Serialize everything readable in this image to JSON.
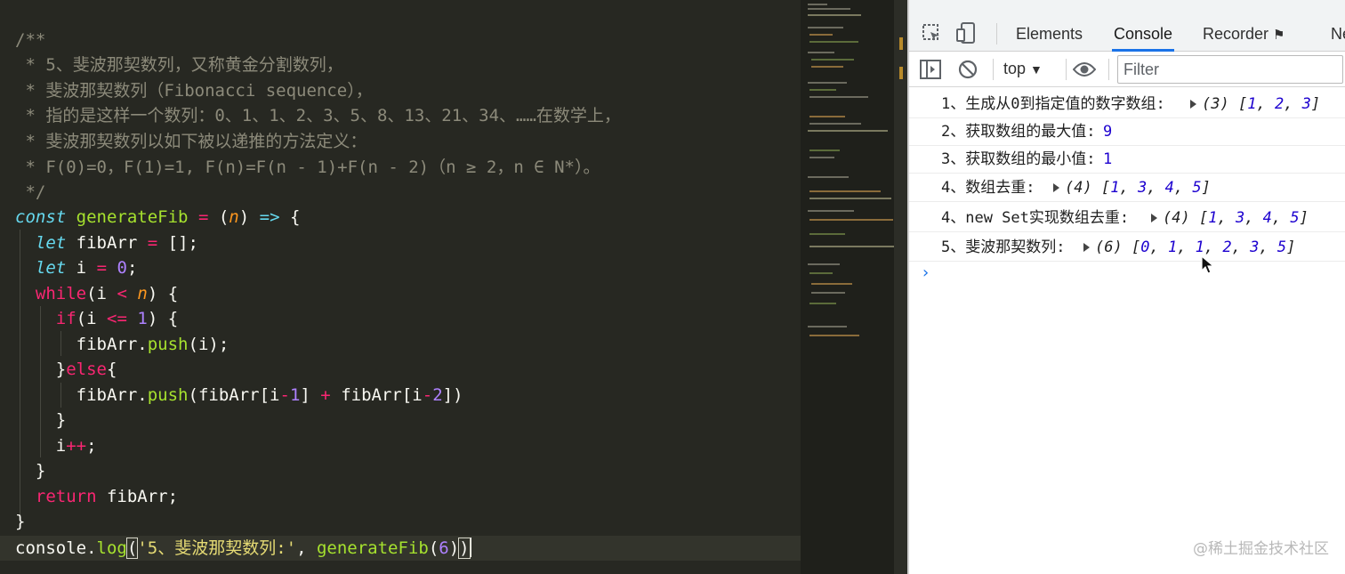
{
  "editor": {
    "lines": [
      "/**",
      " * 5、斐波那契数列，又称黄金分割数列，",
      " * 斐波那契数列（Fibonacci sequence），",
      " * 指的是这样一个数列：0、1、1、2、3、5、8、13、21、34、……在数学上，",
      " * 斐波那契数列以如下被以递推的方法定义：",
      " * F(0)=0，F(1)=1, F(n)=F(n - 1)+F(n - 2)（n ≥ 2，n ∈ N*）。",
      " */"
    ],
    "code": {
      "kw_const": "const",
      "fn_name": "generateFib",
      "param": "n",
      "kw_let": "let",
      "var_arr": "fibArr",
      "var_i": "i",
      "kw_while": "while",
      "kw_if": "if",
      "kw_else": "else",
      "method_push": "push",
      "kw_return": "return",
      "obj_console": "console",
      "method_log": "log",
      "str_label": "'5、斐波那契数列:'",
      "num_zero": "0",
      "num_one": "1",
      "num_two": "2",
      "num_six": "6"
    }
  },
  "devtools": {
    "tabs": [
      "Elements",
      "Console",
      "Recorder",
      "Ne"
    ],
    "active_tab": "Console",
    "context": "top",
    "filter_placeholder": "Filter",
    "logs": [
      {
        "label": "1、生成从0到指定值的数字数组:",
        "kind": "array",
        "count": "(3)",
        "items": [
          "1",
          "2",
          "3"
        ]
      },
      {
        "label": "2、获取数组的最大值:",
        "kind": "number",
        "value": "9"
      },
      {
        "label": "3、获取数组的最小值:",
        "kind": "number",
        "value": "1"
      },
      {
        "label": "4、数组去重:",
        "kind": "array",
        "count": "(4)",
        "items": [
          "1",
          "3",
          "4",
          "5"
        ]
      },
      {
        "label": "4、new Set实现数组去重:",
        "kind": "array",
        "count": "(4)",
        "items": [
          "1",
          "3",
          "4",
          "5"
        ]
      },
      {
        "label": "5、斐波那契数列:",
        "kind": "array",
        "count": "(6)",
        "items": [
          "0",
          "1",
          "1",
          "2",
          "3",
          "5"
        ]
      }
    ],
    "prompt": "›",
    "watermark": "@稀土掘金技术社区"
  }
}
